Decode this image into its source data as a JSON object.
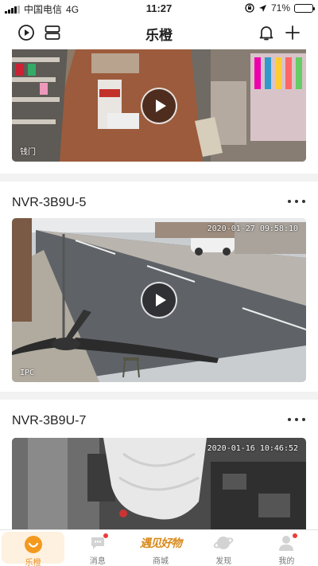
{
  "status_bar": {
    "carrier": "中国电信",
    "network": "4G",
    "time": "11:27",
    "battery_percent": "71%",
    "battery_level": 0.71
  },
  "nav": {
    "title": "乐橙",
    "left_icons": [
      "play-circle-icon",
      "layout-icon"
    ],
    "right_icons": [
      "bell-icon",
      "plus-icon"
    ]
  },
  "cameras": [
    {
      "name": "",
      "timestamp": "",
      "label": "钱门",
      "scene": "store-interior"
    },
    {
      "name": "NVR-3B9U-5",
      "timestamp": "2020-01-27 09:58:10",
      "label": "IPC",
      "scene": "roadside"
    },
    {
      "name": "NVR-3B9U-7",
      "timestamp": "2020-01-16 10:46:52",
      "label": "",
      "scene": "night-interior"
    }
  ],
  "tabs": [
    {
      "label": "乐橙",
      "icon": "lechange-logo-icon",
      "active": true,
      "badge": false
    },
    {
      "label": "消息",
      "icon": "message-icon",
      "active": false,
      "badge": true
    },
    {
      "label": "商城",
      "icon": "mall-brand-icon",
      "brand_text": "遇见好物",
      "active": false,
      "badge": false
    },
    {
      "label": "发现",
      "icon": "planet-icon",
      "active": false,
      "badge": false
    },
    {
      "label": "我的",
      "icon": "user-icon",
      "active": false,
      "badge": true
    }
  ],
  "colors": {
    "accent": "#f39a1e",
    "badge": "#ee3b3b",
    "background": "#f2f2f2"
  }
}
